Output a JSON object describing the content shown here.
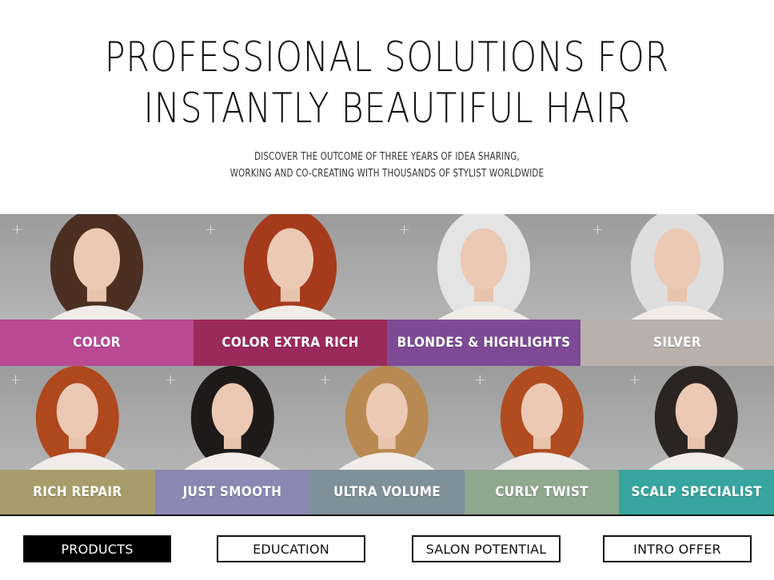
{
  "hero": {
    "headline_line1": "PROFESSIONAL SOLUTIONS FOR",
    "headline_line2": "INSTANTLY BEAUTIFUL HAIR",
    "subhead_line1": "DISCOVER THE OUTCOME OF THREE YEARS OF IDEA SHARING,",
    "subhead_line2": "WORKING AND CO-CREATING WITH THOUSANDS OF STYLIST WORLDWIDE"
  },
  "products_row1": [
    {
      "label": "COLOR",
      "color": "#b94a93",
      "hair": "#4a2f22",
      "icon": "plus-icon"
    },
    {
      "label": "COLOR EXTRA RICH",
      "color": "#9b2a5c",
      "hair": "#a63a1c",
      "icon": "plus-icon"
    },
    {
      "label": "BLONDES & HIGHLIGHTS",
      "color": "#7e4a95",
      "hair": "#e4e4e4",
      "icon": "plus-icon"
    },
    {
      "label": "SILVER",
      "color": "#b8b0ab",
      "hair": "#dedede",
      "icon": "plus-icon"
    }
  ],
  "products_row2": [
    {
      "label": "RICH REPAIR",
      "color": "#a89c6a",
      "hair": "#b0481e",
      "icon": "plus-icon"
    },
    {
      "label": "JUST SMOOTH",
      "color": "#8a88b2",
      "hair": "#1e1a1a",
      "icon": "plus-icon"
    },
    {
      "label": "ULTRA VOLUME",
      "color": "#7e919a",
      "hair": "#b88a52",
      "icon": "plus-icon"
    },
    {
      "label": "CURLY TWIST",
      "color": "#8fa88e",
      "hair": "#b04c20",
      "icon": "plus-icon"
    },
    {
      "label": "SCALP SPECIALIST",
      "color": "#36a59e",
      "hair": "#2a2422",
      "icon": "plus-icon"
    }
  ],
  "nav": {
    "products": "PRODUCTS",
    "education": "EDUCATION",
    "salon_potential": "SALON POTENTIAL",
    "intro_offer": "INTRO OFFER",
    "active": "PRODUCTS"
  }
}
